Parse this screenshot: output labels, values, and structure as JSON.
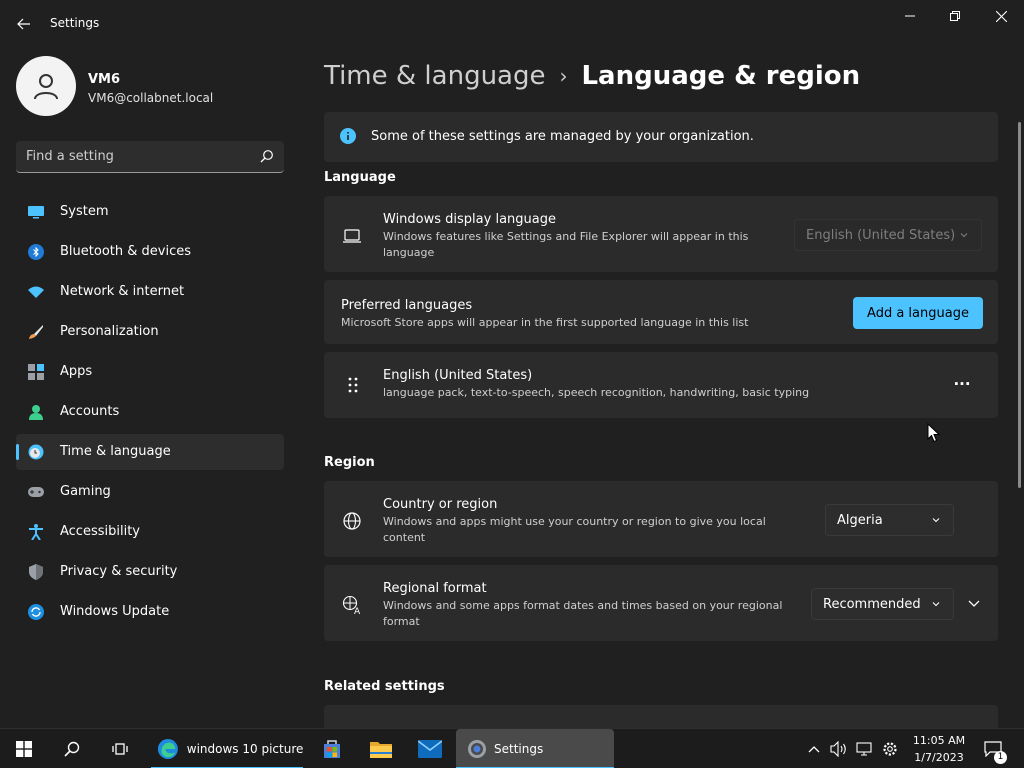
{
  "window": {
    "app_title": "Settings",
    "controls": {
      "minimize": "minimize-icon",
      "maximize": "restore-icon",
      "close": "close-icon"
    }
  },
  "profile": {
    "name": "VM6",
    "email": "VM6@collabnet.local"
  },
  "search": {
    "placeholder": "Find a setting",
    "value": ""
  },
  "sidebar": {
    "items": [
      {
        "label": "System",
        "icon": "system-icon"
      },
      {
        "label": "Bluetooth & devices",
        "icon": "bluetooth-icon"
      },
      {
        "label": "Network & internet",
        "icon": "wifi-icon"
      },
      {
        "label": "Personalization",
        "icon": "brush-icon"
      },
      {
        "label": "Apps",
        "icon": "apps-icon"
      },
      {
        "label": "Accounts",
        "icon": "person-icon"
      },
      {
        "label": "Time & language",
        "icon": "clock-globe-icon",
        "active": true
      },
      {
        "label": "Gaming",
        "icon": "gamepad-icon"
      },
      {
        "label": "Accessibility",
        "icon": "accessibility-icon"
      },
      {
        "label": "Privacy & security",
        "icon": "shield-icon"
      },
      {
        "label": "Windows Update",
        "icon": "update-icon"
      }
    ]
  },
  "breadcrumb": {
    "parent": "Time & language",
    "separator": "›",
    "current": "Language & region"
  },
  "notice": {
    "text": "Some of these settings are managed by your organization."
  },
  "language": {
    "title": "Language",
    "display_language": {
      "title": "Windows display language",
      "desc": "Windows features like Settings and File Explorer will appear in this language",
      "value": "English (United States)"
    },
    "preferred": {
      "title": "Preferred languages",
      "desc": "Microsoft Store apps will appear in the first supported language in this list",
      "button": "Add a language"
    },
    "installed": {
      "title": "English (United States)",
      "desc": "language pack, text-to-speech, speech recognition, handwriting, basic typing",
      "more": "···"
    }
  },
  "region": {
    "title": "Region",
    "country": {
      "title": "Country or region",
      "desc": "Windows and apps might use your country or region to give you local content",
      "value": "Algeria"
    },
    "format": {
      "title": "Regional format",
      "desc": "Windows and some apps format dates and times based on your regional format",
      "value": "Recommended"
    }
  },
  "related": {
    "title": "Related settings"
  },
  "taskbar": {
    "apps": [
      {
        "label": "windows 10 picture...",
        "icon": "edge-icon"
      },
      {
        "label": "Settings",
        "icon": "settings-icon"
      }
    ],
    "time": "11:05 AM",
    "date": "1/7/2023",
    "notifications": "1"
  },
  "colors": {
    "accent": "#4cc2ff",
    "background": "#202020",
    "card": "#2b2b2b"
  }
}
